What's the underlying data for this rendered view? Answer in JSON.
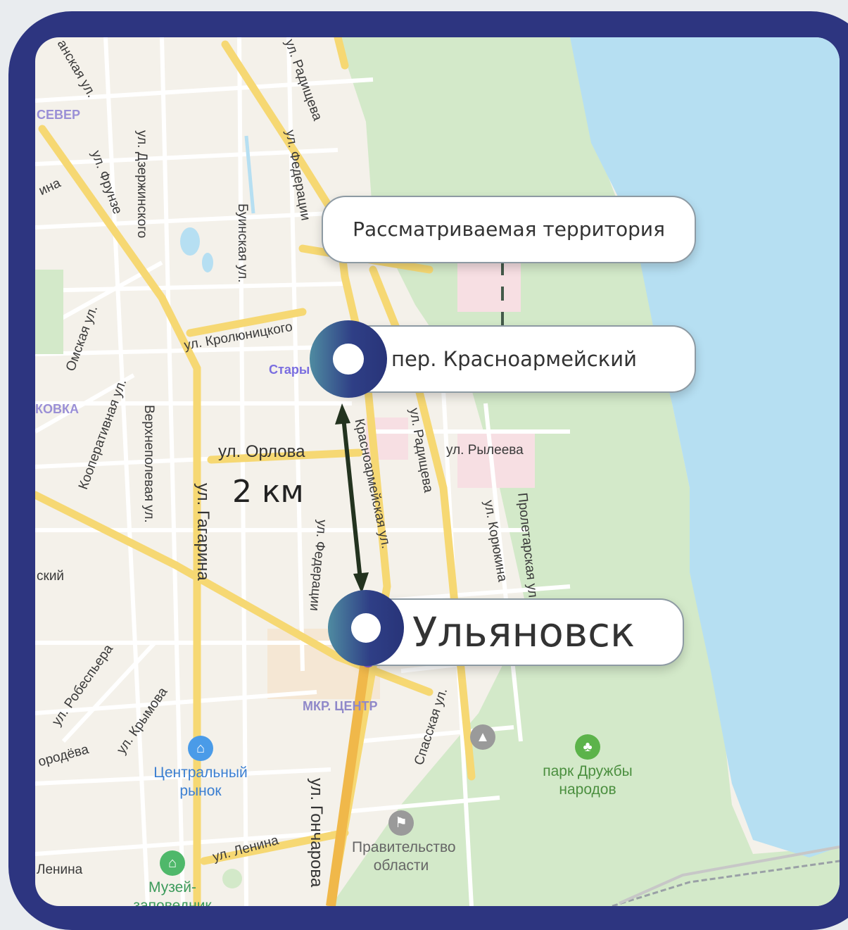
{
  "map": {
    "streets": [
      "ул. Радищева",
      "ул. Федерации",
      "ул. Дзержинского",
      "ул. Фрунзе",
      "Буинская ул.",
      "ул. Кролюницкого",
      "Омская ул.",
      "Кооперативная ул.",
      "Верхнеполевая ул.",
      "ул. Орлова",
      "ул. Гагарина",
      "Красноармейская ул.",
      "ул. Радищева",
      "ул. Рылеева",
      "ул. Корюкина",
      "Пролетарская ул.",
      "ул. Федерации",
      "ул. Робеспьера",
      "ул. Крымова",
      "ул. Гончарова",
      "ул. Ленина",
      "Спасская ул.",
      "Ленина",
      "ородёва",
      "анская ул.",
      "ина",
      "ский"
    ],
    "districts": [
      "СЕВЕР",
      "КОВКА",
      "МКР. ЦЕНТР",
      "Стары"
    ],
    "pois": [
      {
        "name": "Центральный рынок",
        "icon": "market-icon"
      },
      {
        "name": "Правительство области",
        "icon": "flag-icon"
      },
      {
        "name": "парк Дружбы народов",
        "icon": "tree-icon"
      },
      {
        "name": "Музей-заповедник",
        "icon": "museum-icon"
      }
    ],
    "colors": {
      "frame": "#2d3580",
      "water": "#b6dff2",
      "park": "#cfe8c6",
      "road_major": "#f6d873",
      "road": "#ffffff"
    }
  },
  "overlay": {
    "callout_territory": "Рассматриваемая  территория",
    "callout_lane": "пер. Красноармейский",
    "callout_city": "Ульяновск",
    "distance": "2 км"
  }
}
